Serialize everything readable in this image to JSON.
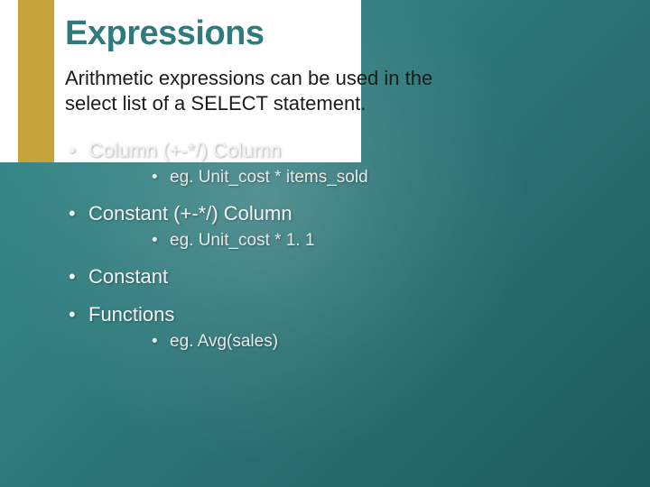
{
  "slide": {
    "title": "Expressions",
    "intro": "Arithmetic expressions can be used in the select list of a SELECT statement.",
    "bullets": [
      {
        "text": "Column (+-*/) Column",
        "sub": [
          "eg. Unit_cost * items_sold"
        ]
      },
      {
        "text": "Constant (+-*/) Column",
        "sub": [
          "eg. Unit_cost * 1. 1"
        ]
      },
      {
        "text": "Constant",
        "sub": []
      },
      {
        "text": "Functions",
        "sub": [
          "eg. Avg(sales)"
        ]
      }
    ]
  }
}
